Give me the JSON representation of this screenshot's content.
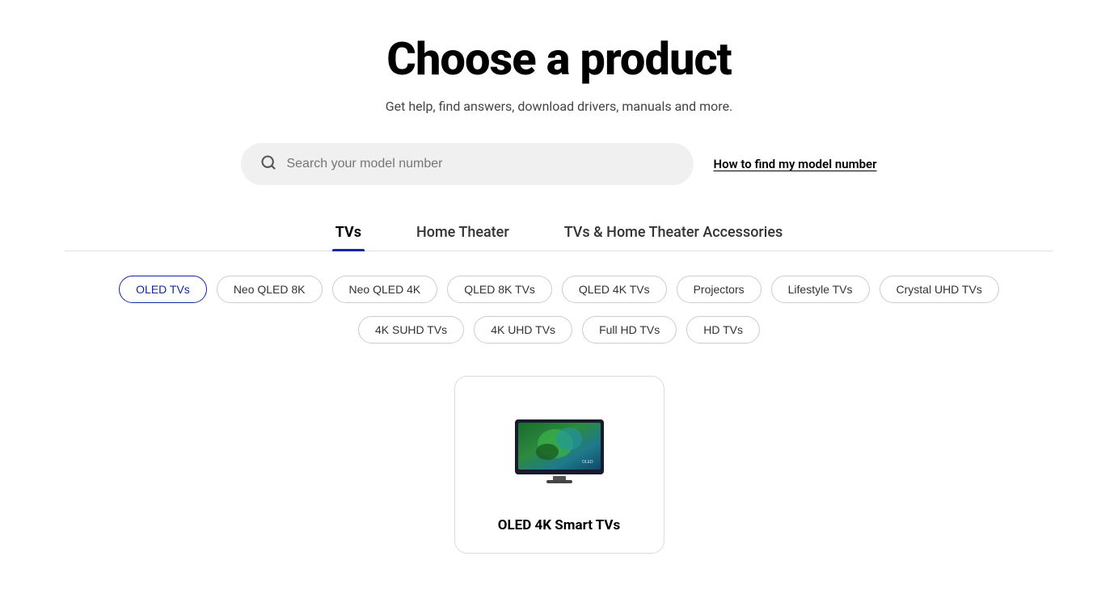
{
  "page": {
    "title": "Choose a product",
    "subtitle": "Get help, find answers, download drivers, manuals and more."
  },
  "search": {
    "placeholder": "Search your model number",
    "model_number_link": "How to find my model number"
  },
  "tabs": [
    {
      "id": "tvs",
      "label": "TVs",
      "active": true
    },
    {
      "id": "home-theater",
      "label": "Home Theater",
      "active": false
    },
    {
      "id": "accessories",
      "label": "TVs & Home Theater Accessories",
      "active": false
    }
  ],
  "filters_row1": [
    {
      "id": "oled-tvs",
      "label": "OLED TVs",
      "active": true
    },
    {
      "id": "neo-qled-8k",
      "label": "Neo QLED 8K",
      "active": false
    },
    {
      "id": "neo-qled-4k",
      "label": "Neo QLED 4K",
      "active": false
    },
    {
      "id": "qled-8k-tvs",
      "label": "QLED 8K TVs",
      "active": false
    },
    {
      "id": "qled-4k-tvs",
      "label": "QLED 4K TVs",
      "active": false
    },
    {
      "id": "projectors",
      "label": "Projectors",
      "active": false
    },
    {
      "id": "lifestyle-tvs",
      "label": "Lifestyle TVs",
      "active": false
    },
    {
      "id": "crystal-uhd-tvs",
      "label": "Crystal UHD TVs",
      "active": false
    }
  ],
  "filters_row2": [
    {
      "id": "4k-suhd-tvs",
      "label": "4K SUHD TVs",
      "active": false
    },
    {
      "id": "4k-uhd-tvs",
      "label": "4K UHD TVs",
      "active": false
    },
    {
      "id": "full-hd-tvs",
      "label": "Full HD TVs",
      "active": false
    },
    {
      "id": "hd-tvs",
      "label": "HD TVs",
      "active": false
    }
  ],
  "products": [
    {
      "id": "oled-4k-smart-tvs",
      "label": "OLED 4K Smart TVs"
    }
  ],
  "colors": {
    "active_tab_underline": "#1428A0",
    "active_pill_border": "#1428A0",
    "active_pill_text": "#1428A0"
  }
}
